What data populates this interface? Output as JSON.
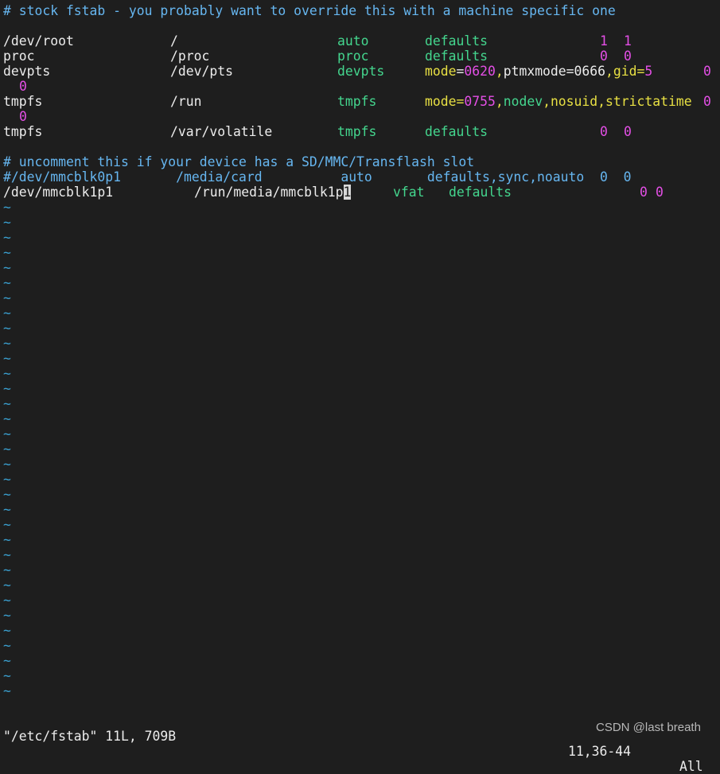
{
  "editor": {
    "comment1": "# stock fstab - you probably want to override this with a machine specific one",
    "rows": [
      {
        "dev": "/dev/root",
        "mnt": "/",
        "type": "auto",
        "opts": "defaults",
        "d": "1",
        "p": "1"
      },
      {
        "dev": "proc",
        "mnt": "/proc",
        "type": "proc",
        "opts": "defaults",
        "d": "0",
        "p": "0"
      },
      {
        "dev": "devpts",
        "mnt": "/dev/pts",
        "type": "devpts"
      },
      {
        "dev": "tmpfs",
        "mnt": "/run",
        "type": "tmpfs"
      },
      {
        "dev": "tmpfs",
        "mnt": "/var/volatile",
        "type": "tmpfs",
        "opts": "defaults",
        "d": "0",
        "p": "0"
      }
    ],
    "devpts_opts": {
      "k1": "mode",
      "eq1": "=",
      "v1": "0620",
      "comma1": ",",
      "k2": "ptmxmode",
      "eq2": "=",
      "v2": "0666",
      "comma2": ",",
      "k3": "gid",
      "eq3": "=",
      "v3": "5",
      "d": "0",
      "p": "0"
    },
    "run_opts": {
      "k1": "mode",
      "eq1": "=",
      "v1": "0755",
      "comma1": ",",
      "o2": "nodev",
      "comma2": ",",
      "o3": "nosuid",
      "comma3": ",",
      "o4": "strictatime",
      "d": "0",
      "p": "0"
    },
    "comment2": "# uncomment this if your device has a SD/MMC/Transflash slot",
    "comment3": "#/dev/mmcblk0p1       /media/card          auto       defaults,sync,noauto  0  0",
    "last": {
      "dev": "/dev/mmcblk1p1",
      "mnt_before_cursor": "/run/media/mmcblk1p",
      "cursor_char": "1",
      "type": "vfat",
      "opts": "defaults",
      "d": "0",
      "p": "0"
    },
    "tilde": "~"
  },
  "status": {
    "file_info": "\"/etc/fstab\" 11L, 709B",
    "position": "11,36-44",
    "scroll": "All"
  },
  "watermark": "CSDN @last breath",
  "colors": {
    "background": "#1e1e1e",
    "comment": "#66b6f0",
    "type": "#44d68e",
    "mode": "#e8e043",
    "number": "#e44fe6",
    "tilde": "#3aa0d0"
  }
}
